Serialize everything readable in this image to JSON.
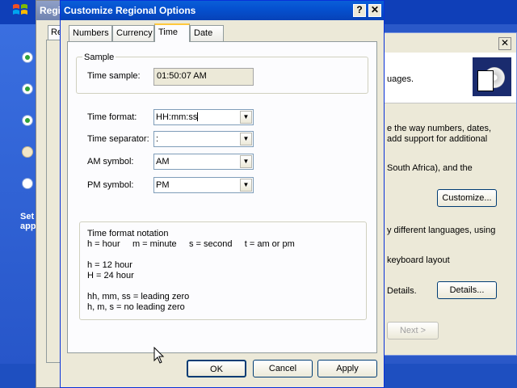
{
  "desktop": {
    "left_caption_line1": "Set",
    "left_caption_line2": "app"
  },
  "back_window": {
    "title": "Regi",
    "tab_fragment": "Re"
  },
  "right_window": {
    "close_glyph": "✕",
    "text_languages": "uages.",
    "text_line1": "e the way numbers, dates,",
    "text_line2": "add support for additional",
    "text_line3": "South Africa), and the",
    "customize_label": "Customize...",
    "text_line4": "y different languages, using",
    "text_line5": "keyboard layout",
    "text_details": "Details.",
    "details_label": "Details...",
    "next_label": "Next >"
  },
  "dialog": {
    "title": "Customize Regional Options",
    "help_glyph": "?",
    "close_glyph": "✕",
    "tabs": [
      {
        "label": "Numbers"
      },
      {
        "label": "Currency"
      },
      {
        "label": "Time"
      },
      {
        "label": "Date"
      }
    ],
    "active_tab": "Time",
    "sample": {
      "group_label": "Sample",
      "time_sample_label": "Time sample:",
      "time_sample_value": "01:50:07 AM"
    },
    "fields": {
      "time_format_label": "Time format:",
      "time_format_value": "HH:mm:ss",
      "time_separator_label": "Time separator:",
      "time_separator_value": ":",
      "am_symbol_label": "AM symbol:",
      "am_symbol_value": "AM",
      "pm_symbol_label": "PM symbol:",
      "pm_symbol_value": "PM"
    },
    "notation": {
      "title": "Time format notation",
      "line1": "h = hour     m = minute     s = second     t = am or pm",
      "line2": "h = 12 hour",
      "line3": "H = 24 hour",
      "line4": "hh, mm, ss = leading zero",
      "line5": "h, m, s = no leading zero"
    },
    "buttons": {
      "ok": "OK",
      "cancel": "Cancel",
      "apply": "Apply"
    }
  },
  "colors": {
    "title_bar": "#0551d0",
    "desktop": "#2a58c8",
    "dialog_face": "#ece9d8",
    "active_tab_accent": "#ffc83c"
  }
}
